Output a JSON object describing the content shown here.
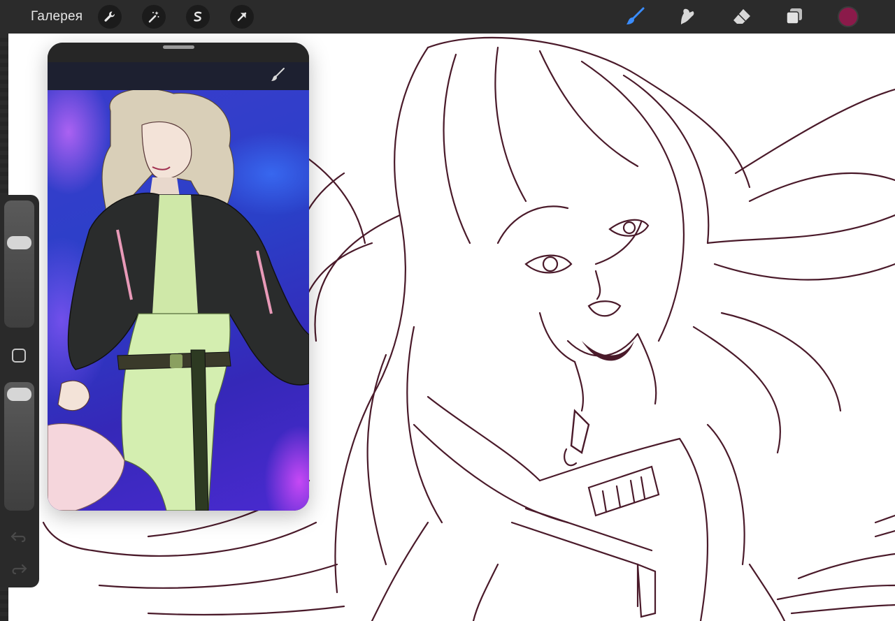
{
  "topbar": {
    "gallery_label": "Галерея",
    "left_tools": [
      "wrench-icon",
      "magic-wand-icon",
      "selection-s-icon",
      "transform-arrow-icon"
    ],
    "right_tools": [
      "brush-icon",
      "smudge-icon",
      "eraser-icon",
      "layers-icon"
    ],
    "active_tool": "brush-icon",
    "current_color": "#8b1a4a",
    "accent_color": "#3a8dff"
  },
  "sidebar": {
    "brush_size_level": 0.7,
    "opacity_level": 0.97,
    "controls": [
      "brush-size-slider",
      "modify-button",
      "opacity-slider",
      "undo-icon",
      "redo-icon"
    ]
  },
  "reference": {
    "panel_icon": "brush-icon"
  },
  "canvas": {
    "line_color": "#4a1a2a",
    "background": "#ffffff"
  }
}
